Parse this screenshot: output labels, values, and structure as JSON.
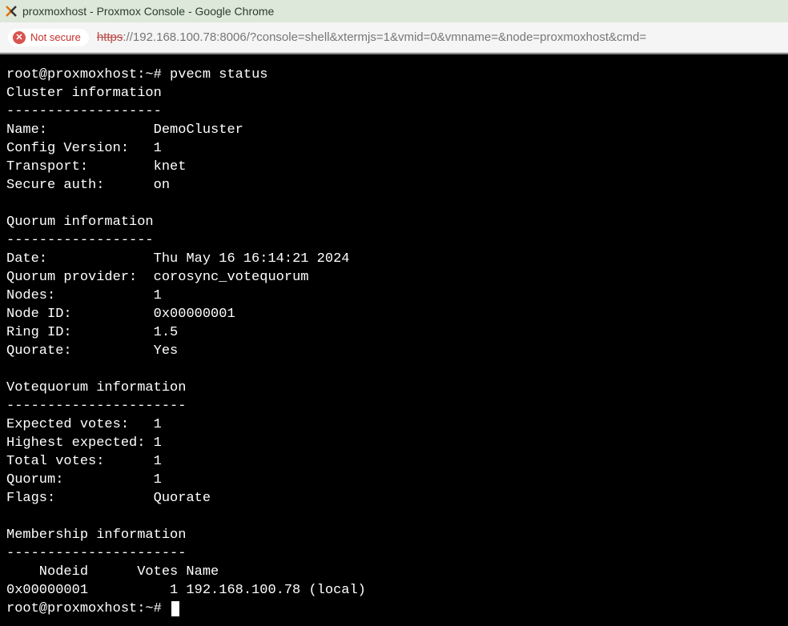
{
  "window": {
    "title": "proxmoxhost - Proxmox Console - Google Chrome"
  },
  "addressbar": {
    "not_secure_label": "Not secure",
    "url_scheme": "https",
    "url_rest": "://192.168.100.78:8006/?console=shell&xtermjs=1&vmid=0&vmname=&node=proxmoxhost&cmd="
  },
  "terminal": {
    "prompt1": "root@proxmoxhost:~# ",
    "command1": "pvecm status",
    "cluster_header": "Cluster information",
    "divider_short": "-------------------",
    "cluster_name_label": "Name:             ",
    "cluster_name_value": "DemoCluster",
    "config_version_label": "Config Version:   ",
    "config_version_value": "1",
    "transport_label": "Transport:        ",
    "transport_value": "knet",
    "secure_auth_label": "Secure auth:      ",
    "secure_auth_value": "on",
    "quorum_header": "Quorum information",
    "divider_quorum": "------------------",
    "date_label": "Date:             ",
    "date_value": "Thu May 16 16:14:21 2024",
    "quorum_provider_label": "Quorum provider:  ",
    "quorum_provider_value": "corosync_votequorum",
    "nodes_label": "Nodes:            ",
    "nodes_value": "1",
    "node_id_label": "Node ID:          ",
    "node_id_value": "0x00000001",
    "ring_id_label": "Ring ID:          ",
    "ring_id_value": "1.5",
    "quorate_label": "Quorate:          ",
    "quorate_value": "Yes",
    "votequorum_header": "Votequorum information",
    "divider_votequorum": "----------------------",
    "expected_votes_label": "Expected votes:   ",
    "expected_votes_value": "1",
    "highest_expected_label": "Highest expected: ",
    "highest_expected_value": "1",
    "total_votes_label": "Total votes:      ",
    "total_votes_value": "1",
    "quorum_label": "Quorum:           ",
    "quorum_value": "1  ",
    "flags_label": "Flags:            ",
    "flags_value": "Quorate ",
    "membership_header": "Membership information",
    "divider_membership": "----------------------",
    "membership_columns": "    Nodeid      Votes Name",
    "membership_row": "0x00000001          1 192.168.100.78 (local)",
    "prompt2": "root@proxmoxhost:~# "
  }
}
